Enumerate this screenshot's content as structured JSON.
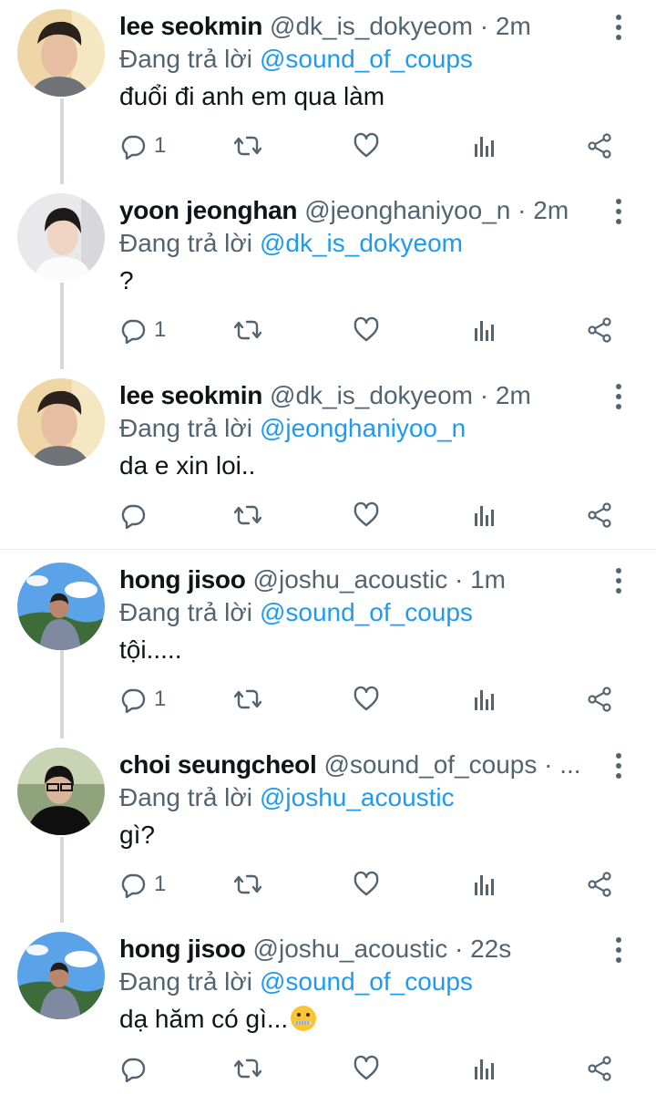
{
  "colors": {
    "accent": "#1d9bf0",
    "secondary_text": "#536471",
    "thread_line": "#cfd9de"
  },
  "replying_label": "Đang trả lời",
  "tweets": [
    {
      "name": "lee seokmin",
      "meta": "@dk_is_dokyeom · 2m",
      "reply_to": "@sound_of_coups",
      "text": "đuổi đi anh em qua làm",
      "reply_count": "1",
      "avatar": "avatar-lee-seokmin"
    },
    {
      "name": "yoon jeonghan",
      "meta": "@jeonghaniyoo_n · 2m",
      "reply_to": "@dk_is_dokyeom",
      "text": "?",
      "reply_count": "1",
      "avatar": "avatar-yoon-jeonghan"
    },
    {
      "name": "lee seokmin",
      "meta": "@dk_is_dokyeom · 2m",
      "reply_to": "@jeonghaniyoo_n",
      "text": "da e xin loi..",
      "reply_count": "",
      "avatar": "avatar-lee-seokmin"
    },
    {
      "name": "hong jisoo",
      "meta": "@joshu_acoustic · 1m",
      "reply_to": "@sound_of_coups",
      "text": "tội.....",
      "reply_count": "1",
      "avatar": "avatar-hong-jisoo"
    },
    {
      "name": "choi seungcheol",
      "meta": "@sound_of_coups · ...",
      "reply_to": "@joshu_acoustic",
      "text": "gì?",
      "reply_count": "1",
      "avatar": "avatar-choi-seungcheol"
    },
    {
      "name": "hong jisoo",
      "meta": "@joshu_acoustic · 22s",
      "reply_to": "@sound_of_coups",
      "text": "dạ hăm có gì...",
      "reply_count": "",
      "avatar": "avatar-hong-jisoo",
      "emoji": "zipper-mouth-face-emoji"
    }
  ]
}
